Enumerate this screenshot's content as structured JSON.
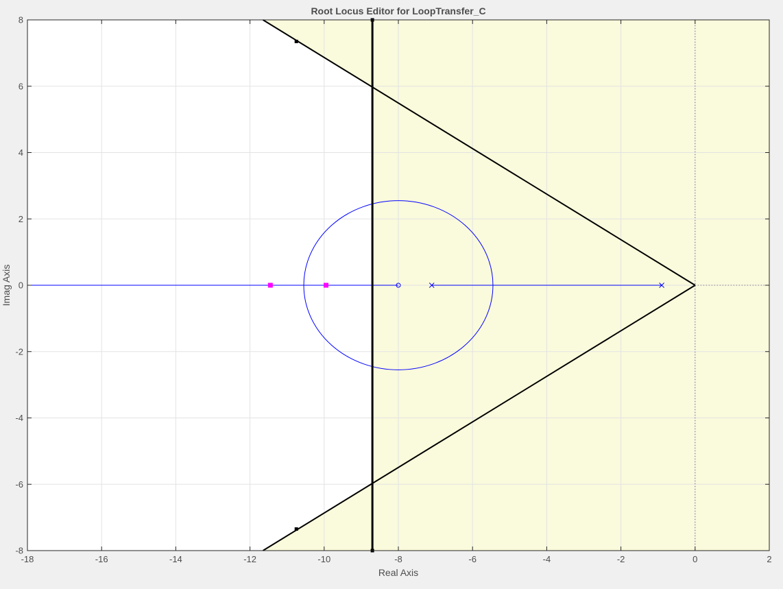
{
  "chart_data": {
    "type": "scatter",
    "title": "Root Locus Editor for LoopTransfer_C",
    "xlabel": "Real Axis",
    "ylabel": "Imag Axis",
    "xlim": [
      -18,
      2
    ],
    "ylim": [
      -8,
      8
    ],
    "xticks": [
      "-18",
      "-16",
      "-14",
      "-12",
      "-10",
      "-8",
      "-6",
      "-4",
      "-2",
      "0",
      "2"
    ],
    "yticks": [
      "-8",
      "-6",
      "-4",
      "-2",
      "0",
      "2",
      "4",
      "6",
      "8"
    ],
    "grid": true,
    "design_region": {
      "settling_time_bound_real": -8.7,
      "damping_boundary_upper": [
        [
          0,
          0
        ],
        [
          -11.65,
          8
        ]
      ],
      "damping_boundary_lower": [
        [
          0,
          0
        ],
        [
          -11.65,
          -8
        ]
      ],
      "fill_color": "#fafadc",
      "boundary_color": "#000000"
    },
    "poles_open_loop": [
      {
        "re": -0.9,
        "im": 0
      },
      {
        "re": -7.1,
        "im": 0
      }
    ],
    "zeros_open_loop": [
      {
        "re": -8.0,
        "im": 0
      }
    ],
    "closed_loop_poles": [
      {
        "re": -11.45,
        "im": 0
      },
      {
        "re": -9.95,
        "im": 0
      }
    ],
    "locus": {
      "color": "#0000ff",
      "real_axis_segments": [
        [
          -0.9,
          -7.1
        ],
        [
          -8.0,
          -18
        ]
      ],
      "circle": {
        "center_re": -8.0,
        "center_im": 0,
        "radius": 2.55
      }
    },
    "closed_loop_pole_color": "#ff00ff",
    "boundary_markers": [
      {
        "re": -10.75,
        "im": 7.35
      },
      {
        "re": -10.75,
        "im": -7.35
      },
      {
        "re": -8.7,
        "im": 8
      },
      {
        "re": -8.7,
        "im": -8
      }
    ]
  }
}
